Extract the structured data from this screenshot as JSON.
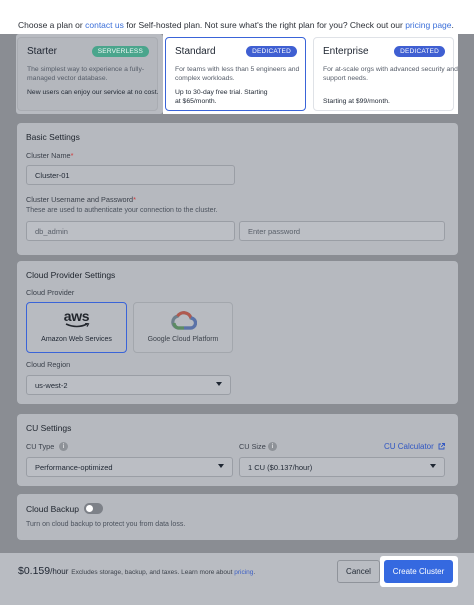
{
  "intro": {
    "text_before": "Choose a plan or ",
    "contact_link": "contact us",
    "text_middle": " for Self-hosted plan. Not sure what's the right plan for you? Check out our ",
    "pricing_link": "pricing page",
    "text_end": "."
  },
  "plans": [
    {
      "title": "Starter",
      "badge": "SERVERLESS",
      "desc": "The simplest way to experience a fully-managed vector database.",
      "note": "New users can enjoy our service at no cost."
    },
    {
      "title": "Standard",
      "badge": "DEDICATED",
      "desc": "For teams with less than 5 engineers and complex workloads.",
      "note": "Up to 30-day free trial. Starting at $65/month."
    },
    {
      "title": "Enterprise",
      "badge": "DEDICATED",
      "desc": "For at-scale orgs with advanced security and support needs.",
      "note": "Starting at $99/month."
    }
  ],
  "basic": {
    "title": "Basic Settings",
    "cluster_name_label": "Cluster Name",
    "cluster_name_value": "Cluster-01",
    "credentials_label": "Cluster Username and Password",
    "credentials_hint": "These are used to authenticate your connection to the cluster.",
    "username_value": "db_admin",
    "password_placeholder": "Enter password",
    "required_mark": "*"
  },
  "cloud": {
    "title": "Cloud Provider Settings",
    "provider_label": "Cloud Provider",
    "providers": [
      {
        "logo": "aws",
        "name": "Amazon Web Services",
        "selected": true
      },
      {
        "logo": "google-cloud-icon",
        "name": "Google Cloud Platform",
        "selected": false
      }
    ],
    "region_label": "Cloud Region",
    "region_value": "us-west-2"
  },
  "cu": {
    "title": "CU Settings",
    "type_label": "CU Type",
    "type_value": "Performance-optimized",
    "size_label": "CU Size",
    "size_value": "1 CU ($0.137/hour)",
    "calculator_label": "CU Calculator",
    "info_glyph": "i"
  },
  "backup": {
    "title": "Cloud Backup",
    "enabled": false,
    "hint": "Turn on cloud backup to protect you from data loss."
  },
  "footer": {
    "price": "$0.159",
    "per": "/hour",
    "note": "Excludes storage, backup, and taxes. Learn more about ",
    "pricing_link": "pricing",
    "note_end": ".",
    "cancel_label": "Cancel",
    "create_label": "Create Cluster"
  },
  "colors": {
    "accent": "#3569e0",
    "serverless_badge": "#4aa58c",
    "dedicated_badge": "#3f5fd2",
    "required": "#d0393a"
  }
}
